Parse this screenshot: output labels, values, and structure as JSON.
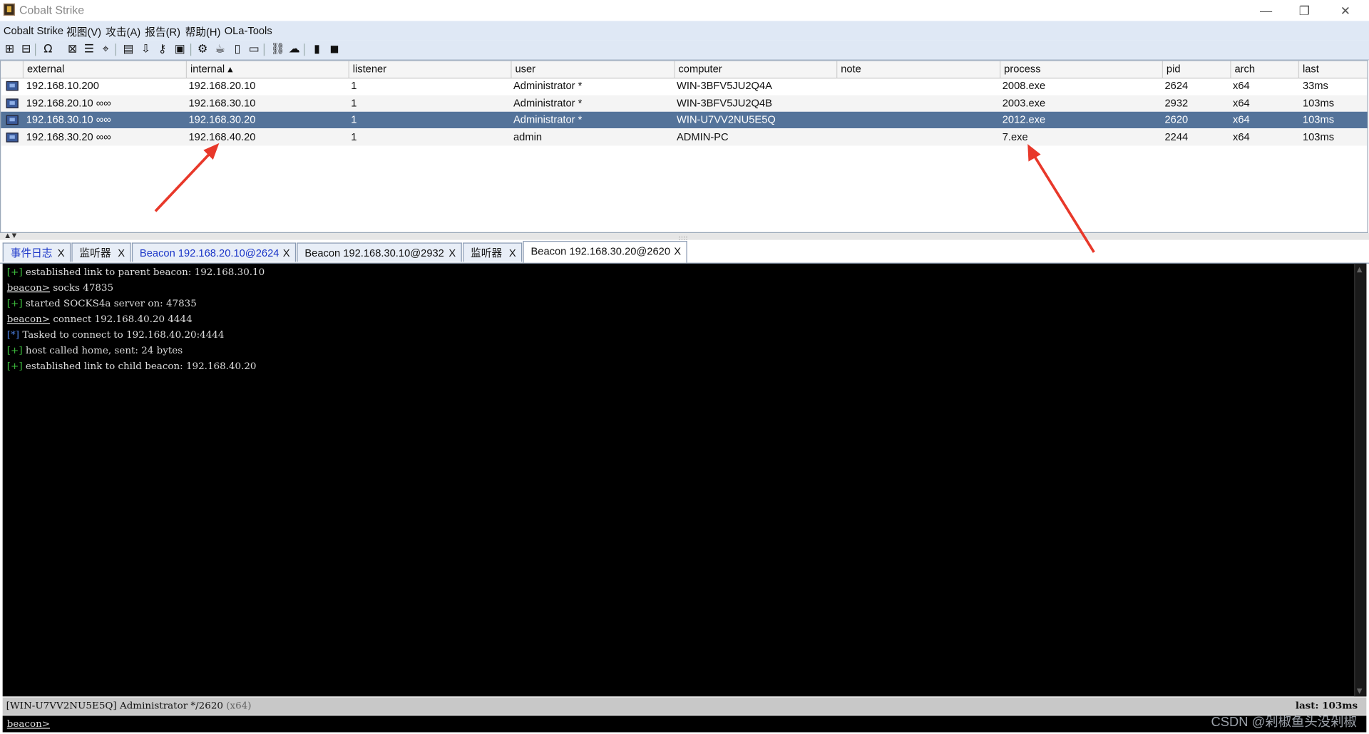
{
  "window": {
    "title": "Cobalt Strike",
    "minimize": "—",
    "restore": "❐",
    "close": "✕"
  },
  "menu": [
    "Cobalt Strike",
    "视图(V)",
    "攻击(A)",
    "报告(R)",
    "帮助(H)",
    "OLa-Tools"
  ],
  "toolbar_icons": [
    {
      "name": "new-connection-icon",
      "glyph": "⊞"
    },
    {
      "name": "disconnect-icon",
      "glyph": "⊟"
    },
    {
      "name": "listeners-headphones-icon",
      "glyph": "Ω"
    },
    {
      "name": "pivot-graph-icon",
      "glyph": "⊠"
    },
    {
      "name": "session-table-icon",
      "glyph": "☰"
    },
    {
      "name": "targets-crosshair-icon",
      "glyph": "⌖"
    },
    {
      "name": "credentials-icon",
      "glyph": "▤"
    },
    {
      "name": "downloads-icon",
      "glyph": "⇩"
    },
    {
      "name": "keystrokes-key-icon",
      "glyph": "⚷"
    },
    {
      "name": "screenshots-image-icon",
      "glyph": "▣"
    },
    {
      "name": "payload-generator-gear-icon",
      "glyph": "⚙"
    },
    {
      "name": "java-cup-icon",
      "glyph": "☕"
    },
    {
      "name": "document-icon",
      "glyph": "▯"
    },
    {
      "name": "script-console-icon",
      "glyph": "▭"
    },
    {
      "name": "link-chain-icon",
      "glyph": "⛓"
    },
    {
      "name": "cloud-icon",
      "glyph": "☁"
    },
    {
      "name": "book-icon",
      "glyph": "▮"
    },
    {
      "name": "package-cube-icon",
      "glyph": "◼"
    }
  ],
  "table": {
    "columns": [
      "external",
      "internal ▴",
      "listener",
      "user",
      "computer",
      "note",
      "process",
      "pid",
      "arch",
      "last"
    ],
    "rows": [
      {
        "external": "192.168.10.200",
        "internal": "192.168.20.10",
        "listener": "1",
        "user": "Administrator *",
        "computer": "WIN-3BFV5JU2Q4A",
        "note": "",
        "process": "2008.exe",
        "pid": "2624",
        "arch": "x64",
        "last": "33ms",
        "selected": false
      },
      {
        "external": "192.168.20.10 ∞∞",
        "internal": "192.168.30.10",
        "listener": "1",
        "user": "Administrator *",
        "computer": "WIN-3BFV5JU2Q4B",
        "note": "",
        "process": "2003.exe",
        "pid": "2932",
        "arch": "x64",
        "last": "103ms",
        "selected": false
      },
      {
        "external": "192.168.30.10 ∞∞",
        "internal": "192.168.30.20",
        "listener": "1",
        "user": "Administrator *",
        "computer": "WIN-U7VV2NU5E5Q",
        "note": "",
        "process": "2012.exe",
        "pid": "2620",
        "arch": "x64",
        "last": "103ms",
        "selected": true
      },
      {
        "external": "192.168.30.20 ∞∞",
        "internal": "192.168.40.20",
        "listener": "1",
        "user": "admin",
        "computer": "ADMIN-PC",
        "note": "",
        "process": "7.exe",
        "pid": "2244",
        "arch": "x64",
        "last": "103ms",
        "selected": false
      }
    ]
  },
  "splitter": {
    "arrows": "▲ ▼",
    "grip": "::::"
  },
  "tabs": [
    {
      "label": "事件日志",
      "close": "X",
      "blue": true
    },
    {
      "label": "监听器",
      "close": "X",
      "blue": false
    },
    {
      "label": "Beacon 192.168.20.10@2624",
      "close": "X",
      "blue": true
    },
    {
      "label": "Beacon 192.168.30.10@2932",
      "close": "X",
      "blue": false
    },
    {
      "label": "监听器",
      "close": "X",
      "blue": false
    },
    {
      "label": "Beacon 192.168.30.20@2620",
      "close": "X",
      "blue": false,
      "active": true
    }
  ],
  "console_lines": [
    {
      "tag": "[+]",
      "kind": "plus",
      "text": " established link to parent beacon: 192.168.30.10"
    },
    {
      "tag": "beacon>",
      "kind": "prompt",
      "text": " socks 47835"
    },
    {
      "tag": "[+]",
      "kind": "plus",
      "text": " started SOCKS4a server on: 47835"
    },
    {
      "tag": "beacon>",
      "kind": "prompt",
      "text": " connect 192.168.40.20 4444"
    },
    {
      "tag": "[*]",
      "kind": "star",
      "text": " Tasked to connect to 192.168.40.20:4444"
    },
    {
      "tag": "[+]",
      "kind": "plus",
      "text": " host called home, sent: 24 bytes"
    },
    {
      "tag": "[+]",
      "kind": "plus",
      "text": " established link to child beacon: 192.168.40.20"
    }
  ],
  "status": {
    "left": "[WIN-U7VV2NU5E5Q] Administrator */2620",
    "arch": " (x64)",
    "right": "last: 103ms"
  },
  "input": {
    "prompt": "beacon>",
    "value": ""
  },
  "scrollbar": {
    "up": "▲",
    "down": "▼"
  },
  "watermark": "CSDN @剁椒鱼头没剁椒",
  "colors": {
    "selected_row": "#54739a",
    "console_bg": "#000000",
    "tag_plus": "#3ec13e",
    "tag_star": "#4b7fe0",
    "tab_blue_text": "#1a35c8",
    "annotation_arrow": "#e8382a"
  }
}
